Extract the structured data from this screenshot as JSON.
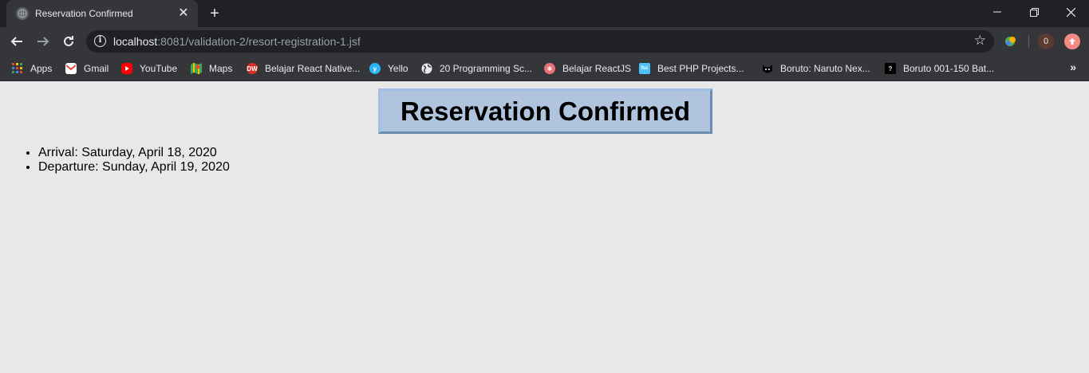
{
  "tab": {
    "title": "Reservation Confirmed",
    "close_label": "✕"
  },
  "new_tab_label": "+",
  "address": {
    "host": "localhost",
    "rest": ":8081/validation-2/resort-registration-1.jsf"
  },
  "extension_badge": "0",
  "bookmarks": [
    {
      "label": "Apps",
      "icon": "apps-grid-icon"
    },
    {
      "label": "Gmail",
      "icon": "gmail-icon"
    },
    {
      "label": "YouTube",
      "icon": "youtube-icon"
    },
    {
      "label": "Maps",
      "icon": "maps-icon"
    },
    {
      "label": "Belajar React Native...",
      "icon": "belajar-react-native-icon"
    },
    {
      "label": "Yello",
      "icon": "yello-icon"
    },
    {
      "label": "20 Programming Sc...",
      "icon": "globe-icon"
    },
    {
      "label": "Belajar ReactJS",
      "icon": "belajar-reactjs-icon"
    },
    {
      "label": "Best PHP Projects...",
      "icon": "php-projects-icon"
    },
    {
      "label": "Boruto: Naruto Nex...",
      "icon": "boruto-naruto-icon"
    },
    {
      "label": "Boruto 001-150 Bat...",
      "icon": "boruto-batch-icon"
    }
  ],
  "bookmarks_overflow": "»",
  "page": {
    "heading": "Reservation Confirmed",
    "details": [
      "Arrival: Saturday, April 18, 2020",
      "Departure: Sunday, April 19, 2020"
    ]
  }
}
